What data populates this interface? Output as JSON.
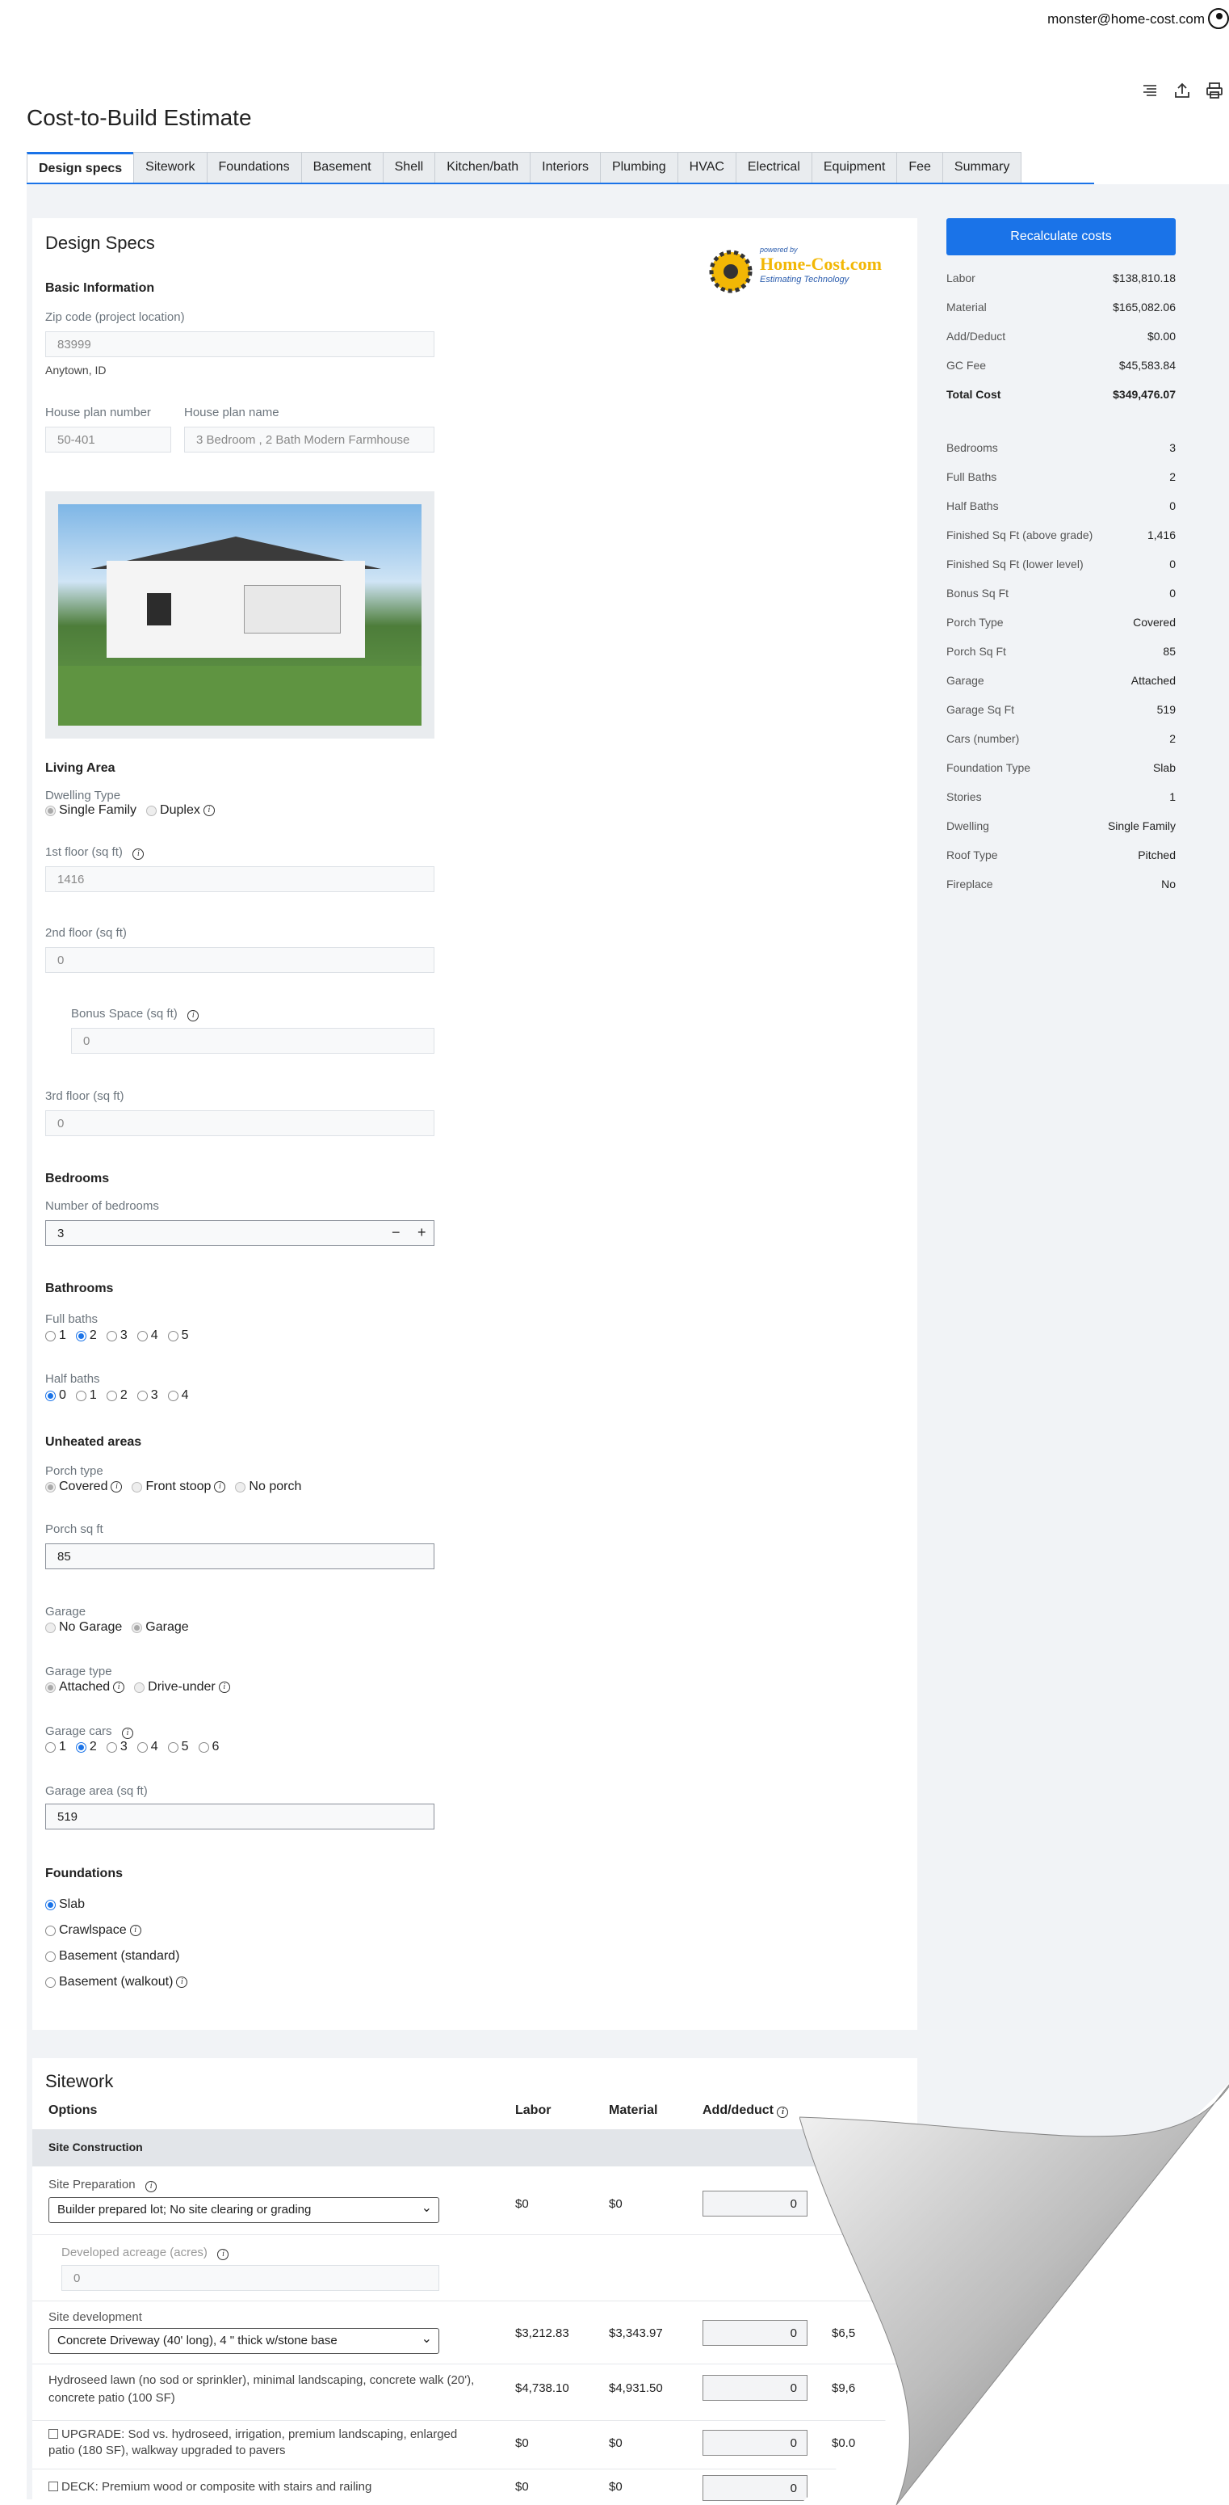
{
  "header": {
    "user_email": "monster@home-cost.com",
    "page_title": "Cost-to-Build Estimate"
  },
  "tabs": [
    "Design specs",
    "Sitework",
    "Foundations",
    "Basement",
    "Shell",
    "Kitchen/bath",
    "Interiors",
    "Plumbing",
    "HVAC",
    "Electrical",
    "Equipment",
    "Fee",
    "Summary"
  ],
  "design": {
    "title": "Design Specs",
    "logo": {
      "powered_by": "powered by",
      "brand": "Home-Cost.com",
      "tagline": "Estimating Technology"
    },
    "basic_info": "Basic Information",
    "zip_label": "Zip code (project location)",
    "zip_value": "83999",
    "city": "Anytown, ID",
    "plan_number_label": "House plan number",
    "plan_number_value": "50-401",
    "plan_name_label": "House plan name",
    "plan_name_value": "3 Bedroom , 2 Bath Modern Farmhouse",
    "living_area": "Living Area",
    "dwelling_type_label": "Dwelling Type",
    "dwelling_single": "Single Family",
    "dwelling_duplex": "Duplex",
    "floor1_label": "1st floor (sq ft)",
    "floor1_value": "1416",
    "floor2_label": "2nd floor (sq ft)",
    "floor2_value": "0",
    "bonus_label": "Bonus Space (sq ft)",
    "bonus_value": "0",
    "floor3_label": "3rd floor (sq ft)",
    "floor3_value": "0",
    "bedrooms": "Bedrooms",
    "num_bedrooms_label": "Number of bedrooms",
    "num_bedrooms_value": "3",
    "minus": "−",
    "plus": "+",
    "bathrooms": "Bathrooms",
    "full_baths_label": "Full baths",
    "full_baths_options": [
      "1",
      "2",
      "3",
      "4",
      "5"
    ],
    "full_baths_selected": "2",
    "half_baths_label": "Half baths",
    "half_baths_options": [
      "0",
      "1",
      "2",
      "3",
      "4"
    ],
    "half_baths_selected": "0",
    "unheated": "Unheated areas",
    "porch_type_label": "Porch type",
    "porch_covered": "Covered",
    "porch_stoop": "Front stoop",
    "porch_none": "No porch",
    "porch_sqft_label": "Porch sq ft",
    "porch_sqft_value": "85",
    "garage_label": "Garage",
    "garage_none": "No Garage",
    "garage_yes": "Garage",
    "garage_type_label": "Garage type",
    "garage_attached": "Attached",
    "garage_driveunder": "Drive-under",
    "garage_cars_label": "Garage cars",
    "garage_cars_options": [
      "1",
      "2",
      "3",
      "4",
      "5",
      "6"
    ],
    "garage_cars_selected": "2",
    "garage_area_label": "Garage area (sq ft)",
    "garage_area_value": "519",
    "foundations": "Foundations",
    "found_slab": "Slab",
    "found_crawl": "Crawlspace",
    "found_basement": "Basement (standard)",
    "found_walkout": "Basement (walkout)"
  },
  "summary": {
    "recalc": "Recalculate costs",
    "costs": [
      {
        "k": "Labor",
        "v": "$138,810.18"
      },
      {
        "k": "Material",
        "v": "$165,082.06"
      },
      {
        "k": "Add/Deduct",
        "v": "$0.00"
      },
      {
        "k": "GC Fee",
        "v": "$45,583.84"
      },
      {
        "k": "Total Cost",
        "v": "$349,476.07"
      }
    ],
    "specs": [
      {
        "k": "Bedrooms",
        "v": "3"
      },
      {
        "k": "Full Baths",
        "v": "2"
      },
      {
        "k": "Half Baths",
        "v": "0"
      },
      {
        "k": "Finished Sq Ft (above grade)",
        "v": "1,416"
      },
      {
        "k": "Finished Sq Ft (lower level)",
        "v": "0"
      },
      {
        "k": "Bonus Sq Ft",
        "v": "0"
      },
      {
        "k": "Porch Type",
        "v": "Covered"
      },
      {
        "k": "Porch Sq Ft",
        "v": "85"
      },
      {
        "k": "Garage",
        "v": "Attached"
      },
      {
        "k": "Garage Sq Ft",
        "v": "519"
      },
      {
        "k": "Cars (number)",
        "v": "2"
      },
      {
        "k": "Foundation Type",
        "v": "Slab"
      },
      {
        "k": "Stories",
        "v": "1"
      },
      {
        "k": "Dwelling",
        "v": "Single Family"
      },
      {
        "k": "Roof Type",
        "v": "Pitched"
      },
      {
        "k": "Fireplace",
        "v": "No"
      }
    ]
  },
  "sitework": {
    "title": "Sitework",
    "col_options": "Options",
    "col_labor": "Labor",
    "col_material": "Material",
    "col_adddeduct": "Add/deduct",
    "band": "Site Construction",
    "site_prep_label": "Site Preparation",
    "site_prep_select": "Builder prepared lot; No site clearing or grading",
    "site_prep_labor": "$0",
    "site_prep_material": "$0",
    "site_prep_add": "0",
    "acreage_label": "Developed acreage (acres)",
    "acreage_value": "0",
    "site_dev_label": "Site development",
    "site_dev_select": "Concrete Driveway (40' long), 4 \" thick w/stone base",
    "site_dev_labor": "$3,212.83",
    "site_dev_material": "$3,343.97",
    "site_dev_add": "0",
    "site_dev_total": "$6,5",
    "hydro_text": "Hydroseed lawn (no sod or sprinkler), minimal landscaping, concrete walk (20'), concrete patio (100 SF)",
    "hydro_labor": "$4,738.10",
    "hydro_material": "$4,931.50",
    "hydro_add": "0",
    "hydro_total": "$9,6",
    "upgrade_text": "UPGRADE: Sod vs. hydroseed, irrigation, premium landscaping, enlarged patio (180 SF), walkway upgraded to pavers",
    "upgrade_labor": "$0",
    "upgrade_material": "$0",
    "upgrade_add": "0",
    "upgrade_total": "$0.0",
    "deck_text": "DECK: Premium wood or composite with stairs and railing",
    "deck_labor": "$0",
    "deck_material": "$0",
    "deck_add": "0"
  }
}
